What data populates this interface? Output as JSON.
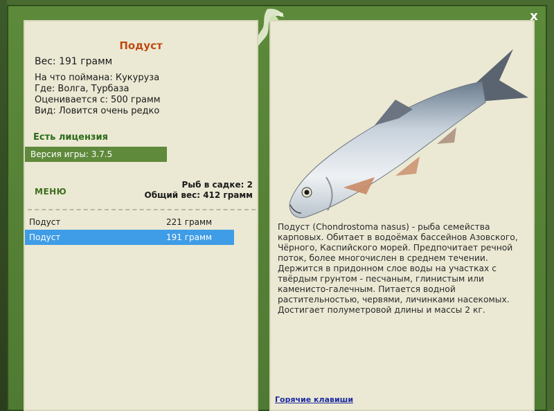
{
  "window": {
    "close_label": "x"
  },
  "fish": {
    "title": "Подуст",
    "weight_line": "Вес: 191 грамм",
    "caught_with": "На что поймана: Кукуруза",
    "where": "Где: Волга, Турбаза",
    "valued_from": "Оценивается с: 500 грамм",
    "rarity": "Вид: Ловится очень редко"
  },
  "license": "Есть лицензия",
  "version": "Версия игры: 3.7.5",
  "menu_label": "МЕНЮ",
  "stats": {
    "count": "Рыб в садке: 2",
    "total_weight": "Общий вес: 412 грамм"
  },
  "catch_list": [
    {
      "name": "Подуст",
      "weight": "221 грамм",
      "selected": false
    },
    {
      "name": "Подуст",
      "weight": "191 грамм",
      "selected": true
    }
  ],
  "description": "Подуст (Chondrostoma nasus) - рыба семейства карповых. Обитает в водоёмах бассейнов Азовского, Чёрного, Каспийского морей. Предпочитает речной поток, более многочислен в среднем течении. Держится в придонном слое воды на участках с твёрдым грунтом - песчаным, глинистым или каменисто-галечным. Питается водной растительностью, червями, личинками насекомых. Достигает полуметровой длины и массы 2 кг.",
  "hotkeys_link": "Горячие клавиши",
  "colors": {
    "frame": "#4f7a33",
    "panel": "#ebe9d4",
    "title": "#c04a10",
    "license": "#2a6a18",
    "selection": "#3f9ce6"
  }
}
